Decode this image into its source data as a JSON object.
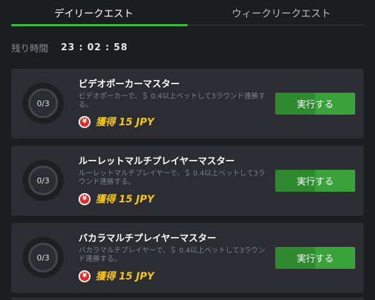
{
  "tabs": {
    "daily": "デイリークエスト",
    "weekly": "ウィークリークエスト"
  },
  "timer": {
    "label": "残り時間",
    "value": "23 : 02 : 58"
  },
  "quests": [
    {
      "progress": "0/3",
      "title": "ビデオポーカーマスター",
      "description": "ビデオポーカーで、＄ 0.4以上ベットして3ラウンド連勝する。",
      "reward": "獲得 15 JPY",
      "button": "実行する"
    },
    {
      "progress": "0/3",
      "title": "ルーレットマルチプレイヤーマスター",
      "description": "ルーレットマルチプレイヤーで、＄ 0.4以上ベットして3ラウンド連勝する。",
      "reward": "獲得 15 JPY",
      "button": "実行する"
    },
    {
      "progress": "0/3",
      "title": "バカラマルチプレイヤーマスター",
      "description": "バカラマルチプレイヤーで、＄ 0.4以上ベットして3ラウンド連勝する。",
      "reward": "獲得 15 JPY",
      "button": "実行する"
    }
  ],
  "icons": {
    "reward": "yen-coin-icon",
    "yen_symbol": "¥"
  },
  "colors": {
    "accent_green": "#3dbb3d",
    "button_green": "#3aa23a",
    "reward_gold": "#f5c518",
    "coin_red": "#e02a2a"
  }
}
